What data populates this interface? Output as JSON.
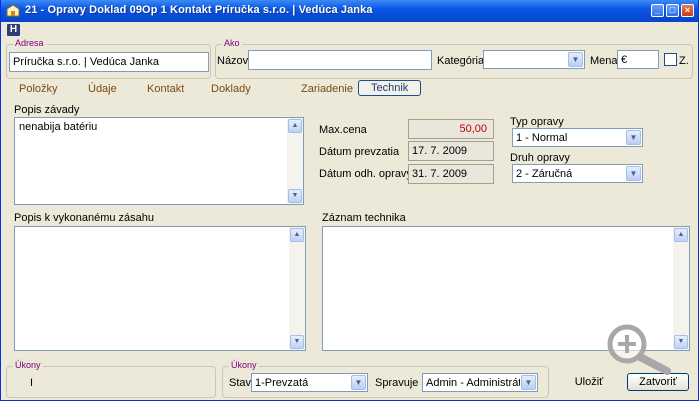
{
  "window": {
    "title": "21 - Opravy   Doklad 09Op 1   Kontakt Príručka s.r.o. | Vedúca Janka",
    "min_glyph": "_",
    "max_glyph": "□",
    "close_glyph": "×"
  },
  "badge": "H",
  "address": {
    "legend": "Adresa",
    "value": "Príručka s.r.o. | Vedúca Janka"
  },
  "ako": {
    "legend": "Ako",
    "name_label": "Názov",
    "name_value": "",
    "category_label": "Kategória",
    "category_value": "",
    "currency_label": "Mena",
    "currency_value": "€",
    "z_label": "Z."
  },
  "tabs": [
    {
      "label": "Položky"
    },
    {
      "label": "Údaje"
    },
    {
      "label": "Kontakt"
    },
    {
      "label": "Doklady"
    },
    {
      "label": "Zariadenie"
    },
    {
      "label": "Technik"
    }
  ],
  "fault": {
    "label": "Popis závady",
    "text": "nenabija batériu"
  },
  "details": {
    "max_price_label": "Max.cena",
    "max_price_value": "50,00",
    "received_label": "Dátum prevzatia",
    "received_value": "17. 7. 2009",
    "est_label": "Dátum odh. opravy",
    "est_value": "31. 7. 2009"
  },
  "repair_type": {
    "label": "Typ opravy",
    "value": "1 - Normal"
  },
  "repair_kind": {
    "label": "Druh opravy",
    "value": "2 - Záručná"
  },
  "work_note": {
    "label": "Popis k vykonanému zásahu",
    "text": ""
  },
  "tech_note": {
    "label": "Záznam technika",
    "text": ""
  },
  "ukony_left": {
    "legend": "Úkony",
    "value": "I"
  },
  "ukony_right": {
    "legend": "Úkony",
    "status_label": "Stav",
    "status_value": "1-Prevzatá",
    "manager_label": "Spravuje",
    "manager_value": "Admin - Administrátor"
  },
  "buttons": {
    "save_label": "Uložiť",
    "close_label": "Zatvoriť"
  },
  "colors": {
    "titlebar": "#0a56e5",
    "legend": "#800080",
    "tab_text": "#7b4a12",
    "price_text": "#c00000"
  }
}
